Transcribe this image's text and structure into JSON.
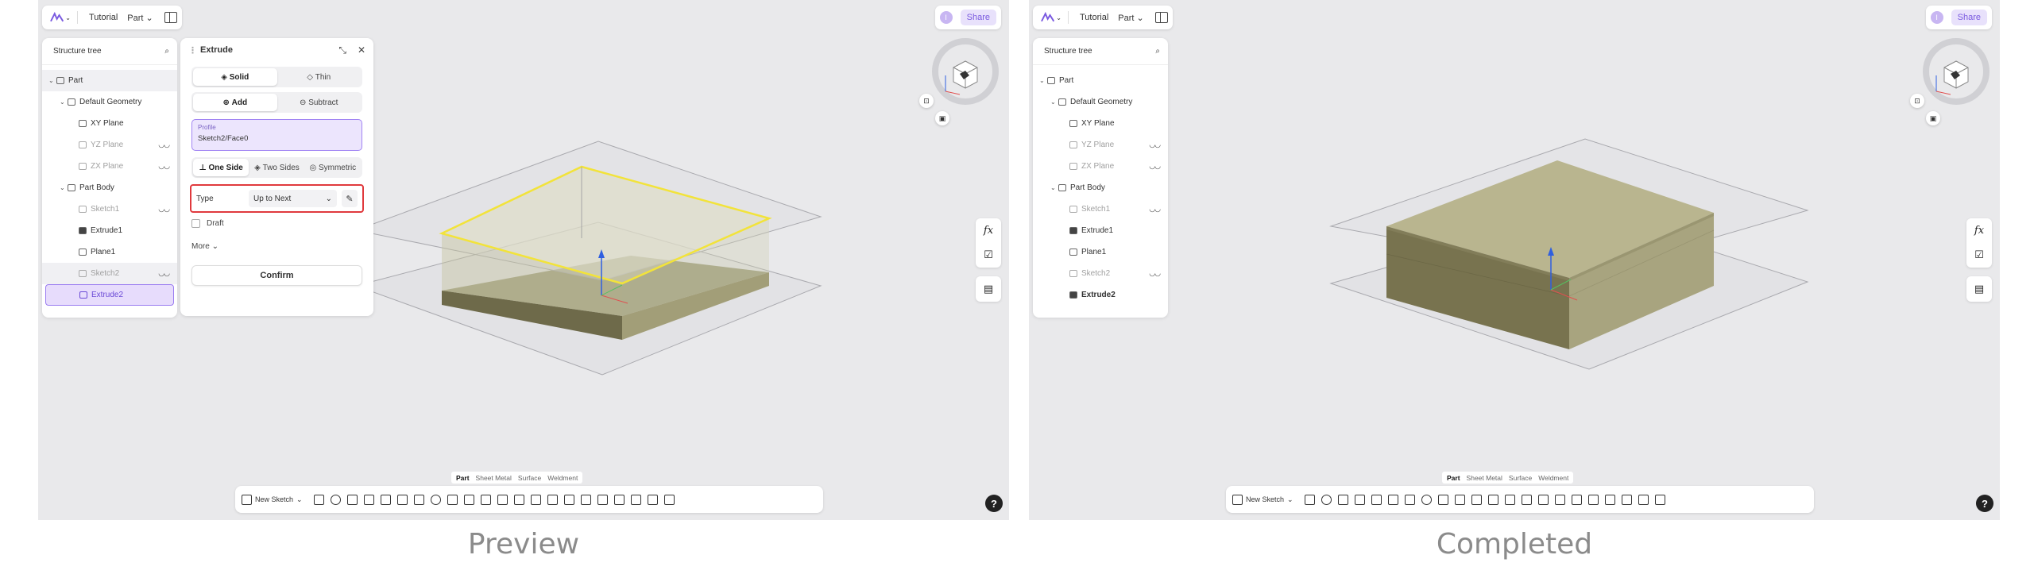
{
  "captions": {
    "left": "Preview",
    "right": "Completed"
  },
  "topbar": {
    "tutorial": "Tutorial",
    "part": "Part",
    "share": "Share",
    "avatar": "I"
  },
  "tree": {
    "title": "Structure tree",
    "items": [
      {
        "label": "Part",
        "level": 0
      },
      {
        "label": "Default Geometry",
        "level": 1
      },
      {
        "label": "XY Plane",
        "level": 2
      },
      {
        "label": "YZ Plane",
        "level": 2
      },
      {
        "label": "ZX Plane",
        "level": 2
      },
      {
        "label": "Part Body",
        "level": 1
      },
      {
        "label": "Sketch1",
        "level": 2
      },
      {
        "label": "Extrude1",
        "level": 2
      },
      {
        "label": "Plane1",
        "level": 2
      },
      {
        "label": "Sketch2",
        "level": 2
      },
      {
        "label": "Extrude2",
        "level": 2
      }
    ]
  },
  "extrude": {
    "title": "Extrude",
    "solid": "Solid",
    "thin": "Thin",
    "add": "Add",
    "subtract": "Subtract",
    "profile_label": "Profile",
    "profile_value": "Sketch2/Face0",
    "one_side": "One Side",
    "two_sides": "Two Sides",
    "symmetric": "Symmetric",
    "type_label": "Type",
    "type_value": "Up to Next",
    "draft": "Draft",
    "more": "More",
    "confirm": "Confirm"
  },
  "modes": {
    "part": "Part",
    "sheet_metal": "Sheet Metal",
    "surface": "Surface",
    "weldment": "Weldment"
  },
  "toolbar": {
    "new_sketch": "New Sketch"
  },
  "rightbar": {
    "fx": "fx"
  },
  "help": "?",
  "colors": {
    "accent": "#7a5ae0",
    "highlight": "#e0393d",
    "solid_top": "#b8b890",
    "solid_side": "#7b7855",
    "selected_edge": "#f2e33a"
  }
}
